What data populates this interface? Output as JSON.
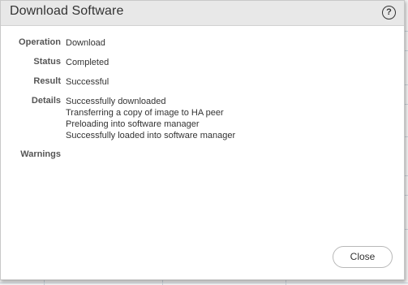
{
  "dialog": {
    "title": "Download Software",
    "help_icon": "question-circle-icon",
    "help_glyph": "?"
  },
  "fields": {
    "operation": {
      "label": "Operation",
      "value": "Download"
    },
    "status": {
      "label": "Status",
      "value": "Completed"
    },
    "result": {
      "label": "Result",
      "value": "Successful"
    },
    "details": {
      "label": "Details",
      "lines": [
        "Successfully downloaded",
        "Transferring a copy of image to HA peer",
        "Preloading into software manager",
        "Successfully loaded into software manager"
      ]
    },
    "warnings": {
      "label": "Warnings",
      "value": ""
    }
  },
  "footer": {
    "close_label": "Close"
  }
}
